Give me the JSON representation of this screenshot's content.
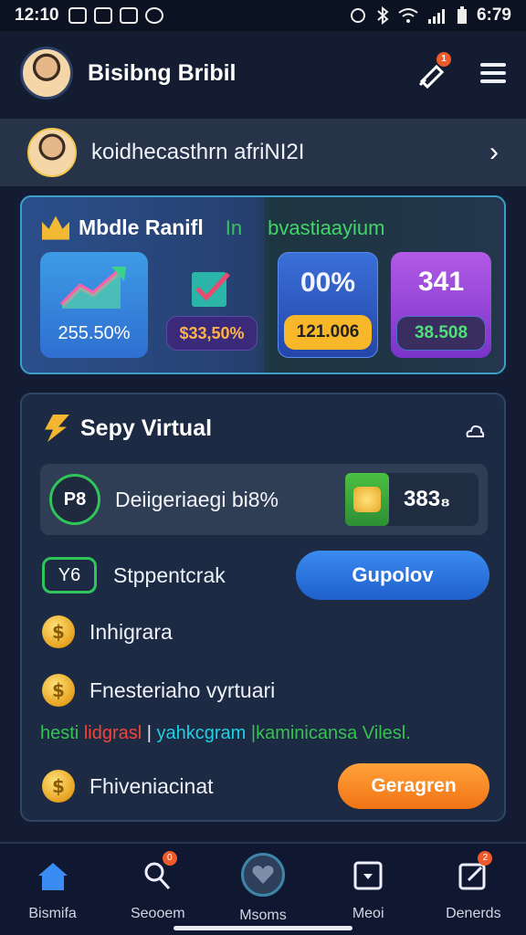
{
  "status_bar": {
    "time": "12:10",
    "right_time": "6:79"
  },
  "header": {
    "title": "Bisibng Bribil",
    "notification_badge": "1"
  },
  "profile_row": {
    "text": "koidhecasthrn afriNI2I"
  },
  "stats_card": {
    "title": "Mbdle Ranifl",
    "tag1": "In",
    "tag2": "bvastiaayium",
    "tiles": [
      {
        "value": "",
        "pill": "255.50%"
      },
      {
        "value": "",
        "pill": "$33,50%"
      },
      {
        "value": "00%",
        "pill": "121.006"
      },
      {
        "value": "341",
        "pill": "38.508"
      }
    ]
  },
  "virtual_card": {
    "title": "Sepy Virtual",
    "row1": {
      "badge": "P8",
      "label": "Deiigeriaegi bi8%",
      "value": "383₈"
    },
    "row2": {
      "badge": "Y6",
      "label": "Stppentcrak",
      "button": "Gupolov"
    },
    "row3": {
      "label": "Inhigrara"
    },
    "row4": {
      "label": "Fnesteriaho vyrtuari"
    },
    "colored_line": {
      "part1": "hesti",
      "part2": "lidgrasl",
      "part3": " | ",
      "part4": "yahkcgram",
      "part5": " |kaminicansa Vilesl."
    },
    "row5": {
      "label": "Fhiveniacinat",
      "button": "Geragren"
    }
  },
  "bottom_nav": [
    {
      "label": "Bismifa",
      "icon": "home-icon"
    },
    {
      "label": "Seooem",
      "icon": "search-icon",
      "badge": "0"
    },
    {
      "label": "Msoms",
      "icon": "center-icon"
    },
    {
      "label": "Meoi",
      "icon": "inbox-icon"
    },
    {
      "label": "Denerds",
      "icon": "edit-icon",
      "badge": "2"
    }
  ]
}
